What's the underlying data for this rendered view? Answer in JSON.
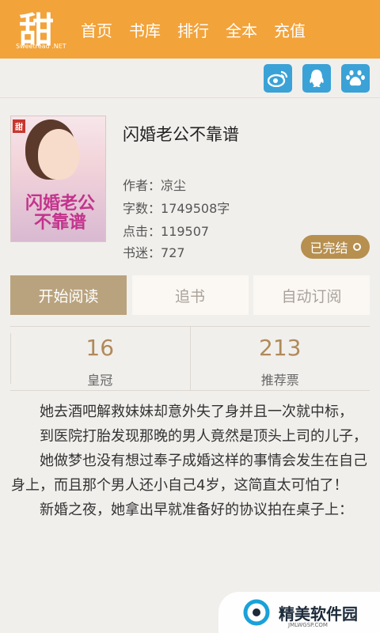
{
  "header": {
    "logo_glyph": "甜",
    "logo_sub": "Sweetread .NET",
    "nav": [
      "首页",
      "书库",
      "排行",
      "全本",
      "充值"
    ],
    "brand_color": "#f2a33a"
  },
  "social": {
    "icons": [
      "weibo-icon",
      "qq-icon",
      "baidu-icon"
    ],
    "icon_color": "#3aa2d6"
  },
  "book": {
    "cover_tag": "甜",
    "cover_title": "闪婚老公不靠谱",
    "title": "闪婚老公不靠谱",
    "author_label": "作者：",
    "author": "凉尘",
    "words_label": "字数：",
    "words": "1749508字",
    "clicks_label": "点击：",
    "clicks": "119507",
    "fans_label": "书迷：",
    "fans": "727",
    "status": "已完结"
  },
  "actions": {
    "read": "开始阅读",
    "follow": "追书",
    "auto_subscribe": "自动订阅"
  },
  "stats": [
    {
      "value": "16",
      "label": "皇冠"
    },
    {
      "value": "213",
      "label": "推荐票"
    }
  ],
  "description": [
    "她去酒吧解救妹妹却意外失了身并且一次就中标，",
    "到医院打胎发现那晚的男人竟然是顶头上司的儿子，",
    "她做梦也没有想过奉子成婚这样的事情会发生在自己身上，而且那个男人还小自己4岁，这简直太可怕了！",
    "新婚之夜，她拿出早就准备好的协议拍在桌子上："
  ],
  "watermark": {
    "text": "精美软件园",
    "sub": "JMLWGSP.COM"
  }
}
